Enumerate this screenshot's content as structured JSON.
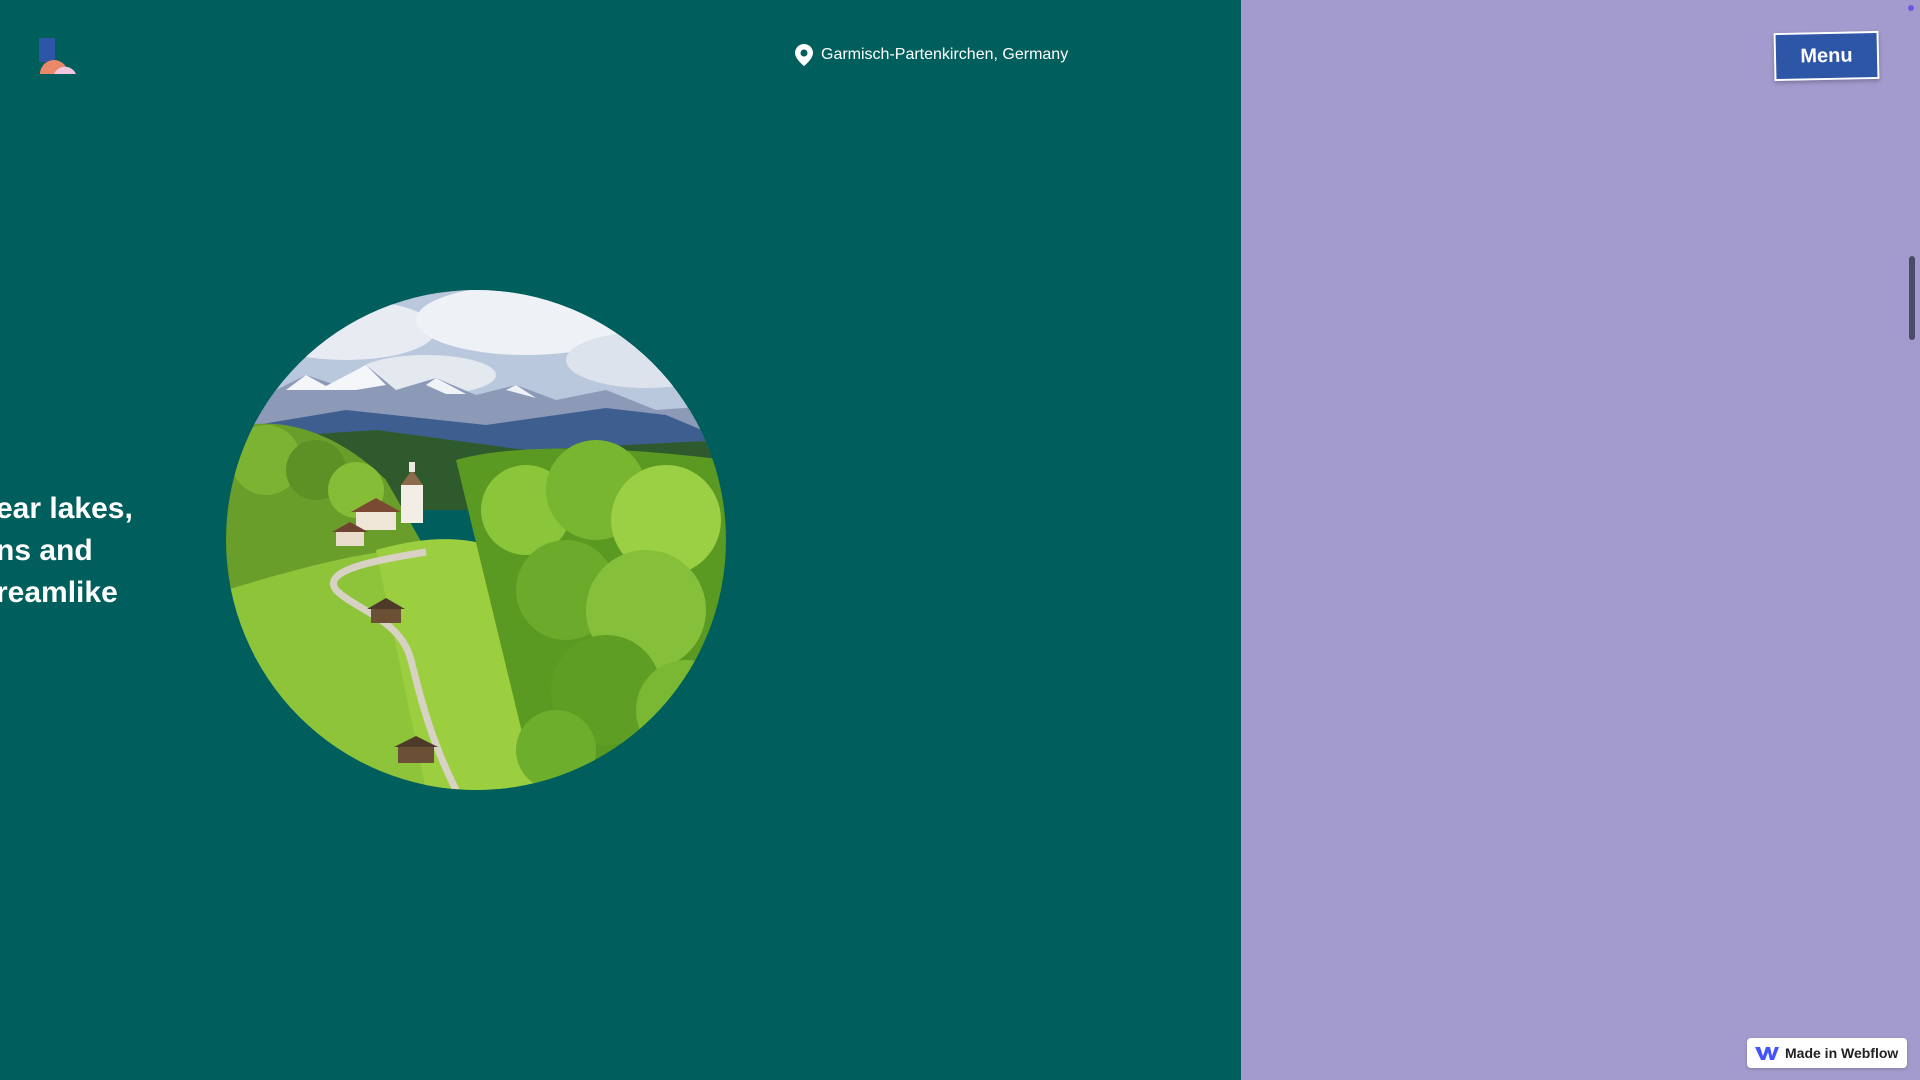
{
  "header": {
    "location_text": "Garmisch-Partenkirchen, Germany",
    "menu_label": "Menu"
  },
  "hero": {
    "headline_lines": [
      "ear lakes,",
      "ns and",
      "reamlike"
    ]
  },
  "badge": {
    "label": "Made in Webflow"
  },
  "colors": {
    "left_panel": "#005E5C",
    "right_panel": "#A39BCD",
    "menu_button": "#2E56A6"
  },
  "icons": {
    "logo": "brand-logo-icon",
    "location": "map-pin-icon",
    "webflow": "webflow-logo-icon"
  }
}
